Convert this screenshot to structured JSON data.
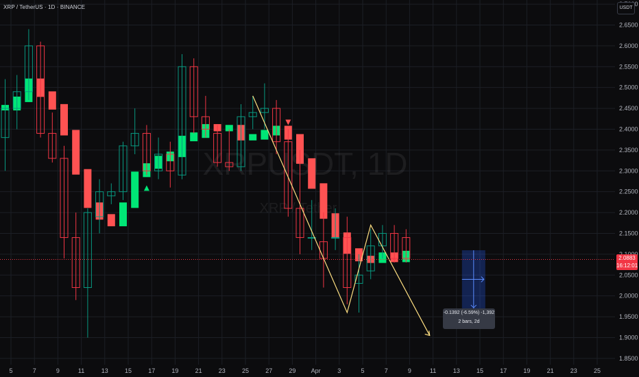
{
  "header": {
    "symbol": "XRP / TetherUS · 1D · BINANCE"
  },
  "currency_button": {
    "label": "USDT"
  },
  "price_badge": {
    "price": "2.0883",
    "countdown": "16:12:01"
  },
  "watermark": {
    "line1": "XRPUSDT, 1D",
    "line2": "XRP / Tether"
  },
  "measure_tooltip": {
    "line1": "-0.1392 (-6.59%) -1,392",
    "line2": "2 bars, 2d"
  },
  "colors": {
    "up": "#089981",
    "down": "#f23645",
    "bright_up": "#00e676",
    "bright_down": "#ff5252",
    "drawing": "#ffe082",
    "measure": "#2962ff"
  },
  "chart_data": {
    "type": "candlestick",
    "y_axis": {
      "ticks": [
        "1.8500",
        "1.9000",
        "1.9500",
        "2.0000",
        "2.0500",
        "2.1000",
        "2.1500",
        "2.2000",
        "2.2500",
        "2.3000",
        "2.3500",
        "2.4000",
        "2.4500",
        "2.5000",
        "2.5500",
        "2.6000",
        "2.6500",
        "2.7000"
      ],
      "range": [
        1.835,
        2.71
      ]
    },
    "x_axis": {
      "ticks": [
        "5",
        "7",
        "9",
        "11",
        "13",
        "15",
        "17",
        "19",
        "21",
        "23",
        "25",
        "27",
        "29",
        "Apr",
        "3",
        "5",
        "7",
        "9",
        "11",
        "13",
        "15",
        "17",
        "19",
        "21",
        "23",
        "25"
      ]
    },
    "candles": [
      {
        "o": 2.38,
        "h": 2.52,
        "l": 2.3,
        "c": 2.45
      },
      {
        "o": 2.45,
        "h": 2.53,
        "l": 2.4,
        "c": 2.49
      },
      {
        "o": 2.49,
        "h": 2.64,
        "l": 2.47,
        "c": 2.6
      },
      {
        "o": 2.6,
        "h": 2.61,
        "l": 2.38,
        "c": 2.39
      },
      {
        "o": 2.39,
        "h": 2.44,
        "l": 2.32,
        "c": 2.33
      },
      {
        "o": 2.33,
        "h": 2.36,
        "l": 2.09,
        "c": 2.14
      },
      {
        "o": 2.14,
        "h": 2.2,
        "l": 1.99,
        "c": 2.02
      },
      {
        "o": 2.02,
        "h": 2.21,
        "l": 1.9,
        "c": 2.2
      },
      {
        "o": 2.19,
        "h": 2.28,
        "l": 2.15,
        "c": 2.25
      },
      {
        "o": 2.24,
        "h": 2.27,
        "l": 2.22,
        "c": 2.25
      },
      {
        "o": 2.25,
        "h": 2.37,
        "l": 2.23,
        "c": 2.36
      },
      {
        "o": 2.36,
        "h": 2.45,
        "l": 2.34,
        "c": 2.39
      },
      {
        "o": 2.39,
        "h": 2.41,
        "l": 2.29,
        "c": 2.3
      },
      {
        "o": 2.3,
        "h": 2.38,
        "l": 2.28,
        "c": 2.34
      },
      {
        "o": 2.34,
        "h": 2.37,
        "l": 2.26,
        "c": 2.3
      },
      {
        "o": 2.29,
        "h": 2.58,
        "l": 2.28,
        "c": 2.55
      },
      {
        "o": 2.55,
        "h": 2.57,
        "l": 2.39,
        "c": 2.43
      },
      {
        "o": 2.43,
        "h": 2.48,
        "l": 2.38,
        "c": 2.4
      },
      {
        "o": 2.39,
        "h": 2.41,
        "l": 2.31,
        "c": 2.32
      },
      {
        "o": 2.32,
        "h": 2.4,
        "l": 2.3,
        "c": 2.31
      },
      {
        "o": 2.31,
        "h": 2.46,
        "l": 2.3,
        "c": 2.43
      },
      {
        "o": 2.43,
        "h": 2.48,
        "l": 2.4,
        "c": 2.44
      },
      {
        "o": 2.44,
        "h": 2.51,
        "l": 2.4,
        "c": 2.45
      },
      {
        "o": 2.45,
        "h": 2.47,
        "l": 2.34,
        "c": 2.37
      },
      {
        "o": 2.37,
        "h": 2.4,
        "l": 2.19,
        "c": 2.21
      },
      {
        "o": 2.21,
        "h": 2.35,
        "l": 2.1,
        "c": 2.14
      },
      {
        "o": 2.14,
        "h": 2.23,
        "l": 2.11,
        "c": 2.14
      },
      {
        "o": 2.13,
        "h": 2.2,
        "l": 2.02,
        "c": 2.09
      },
      {
        "o": 2.14,
        "h": 2.21,
        "l": 2.11,
        "c": 2.14
      },
      {
        "o": 2.14,
        "h": 2.19,
        "l": 1.98,
        "c": 2.02
      },
      {
        "o": 2.03,
        "h": 2.1,
        "l": 1.96,
        "c": 2.05
      },
      {
        "o": 2.06,
        "h": 2.16,
        "l": 2.04,
        "c": 2.12
      },
      {
        "o": 2.12,
        "h": 2.17,
        "l": 2.09,
        "c": 2.15
      },
      {
        "o": 2.15,
        "h": 2.17,
        "l": 2.08,
        "c": 2.09
      },
      {
        "o": 2.14,
        "h": 2.16,
        "l": 2.08,
        "c": 2.09
      }
    ],
    "current_price": 2.0883,
    "signals": [
      {
        "bar": 4,
        "type": "sell"
      },
      {
        "bar": 12,
        "type": "buy"
      },
      {
        "bar": 24,
        "type": "sell"
      }
    ]
  }
}
